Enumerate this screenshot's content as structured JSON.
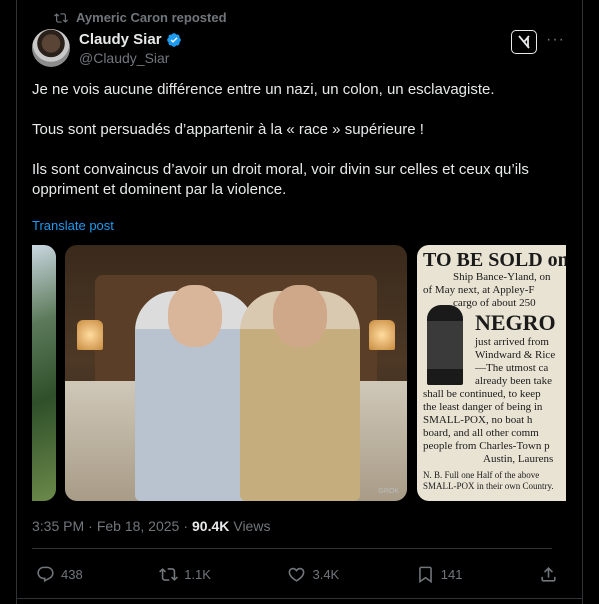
{
  "repost": {
    "text": "Aymeric Caron reposted",
    "icon": "repost-icon"
  },
  "author": {
    "name": "Claudy Siar",
    "handle": "@Claudy_Siar",
    "verified": true,
    "verified_color": "#1d9bf0"
  },
  "post": {
    "paragraphs": [
      "Je ne vois aucune différence entre un nazi, un colon, un esclavagiste.",
      "Tous sont persuadés d’appartenir à la « race » supérieure !",
      "Ils sont convaincus d’avoir un droit moral, voir divin sur celles et ceux qu’ils oppriment et dominent par la violence."
    ],
    "translate_label": "Translate post"
  },
  "media": {
    "image2_watermark": "GROK",
    "poster": {
      "line1": "TO BE SOLD on",
      "line2": "Ship Bance-Yland, on",
      "line3": "of May next, at Appley-F",
      "line4": "cargo of about 250",
      "headline": "NEGRO",
      "line5": "just arrived from",
      "line6": "Windward & Rice",
      "line7": "—The utmost ca",
      "line8": "already been take",
      "line9": "shall be continued, to keep",
      "line10": "the least danger of being in",
      "line11": "SMALL-POX, no boat h",
      "line12": "board, and all other comm",
      "line13": "people from Charles-Town p",
      "line14": "Austin, Laurens",
      "footnote1": "N. B. Full one Half of the above",
      "footnote2": "SMALL-POX in their own Country."
    }
  },
  "meta": {
    "time": "3:35 PM",
    "separator": "·",
    "date": "Feb 18, 2025",
    "views_count": "90.4K",
    "views_label": "Views"
  },
  "actions": {
    "replies": "438",
    "reposts": "1.1K",
    "likes": "3.4K",
    "bookmarks": "141"
  }
}
